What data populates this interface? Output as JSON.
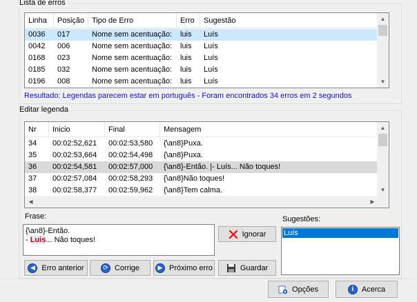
{
  "errors_group": {
    "title": "Lista de erros",
    "columns": [
      "Linha",
      "Posição",
      "Tipo de Erro",
      "Erro",
      "Sugestão"
    ],
    "rows": [
      [
        "0036",
        "017",
        "Nome sem acentuação:",
        "luis",
        "Luís"
      ],
      [
        "0042",
        "006",
        "Nome sem acentuação:",
        "luis",
        "Luís"
      ],
      [
        "0168",
        "023",
        "Nome sem acentuação:",
        "luis",
        "Luís"
      ],
      [
        "0185",
        "032",
        "Nome sem acentuação:",
        "luis",
        "Luís"
      ],
      [
        "0196",
        "008",
        "Nome sem acentuação:",
        "luis",
        "Luís"
      ]
    ],
    "result": "Resultado: Legendas parecem estar em português - Foram encontrados 34 erros em 2 segundos"
  },
  "edit_group": {
    "title": "Editar legenda",
    "columns": [
      "Nr",
      "Inicio",
      "Final",
      "Mensagem"
    ],
    "rows": [
      [
        "34",
        "00:02:52,621",
        "00:02:53,580",
        "{\\an8}Puxa."
      ],
      [
        "35",
        "00:02:53,664",
        "00:02:54,498",
        "{\\an8}Puxa."
      ],
      [
        "36",
        "00:02:54,581",
        "00:02:57,000",
        "{\\an8}-Então. |- Luís... Não toques!"
      ],
      [
        "37",
        "00:02:57,084",
        "00:02:58,293",
        "{\\an8}Não toques!"
      ],
      [
        "38",
        "00:02:58,377",
        "00:02:59,962",
        "{\\an8}Tem calma."
      ]
    ]
  },
  "phrase": {
    "label": "Frase:",
    "line1": "{\\an8}-Então.",
    "line2_prefix": "- ",
    "line2_highlight": "Luis",
    "line2_suffix": "... Não toques!"
  },
  "suggestions": {
    "label": "Sugestões:",
    "items": [
      "Luís"
    ]
  },
  "buttons": {
    "ignore": "Ignorar",
    "save": "Guardar",
    "prev_error": "Erro anterior",
    "fix": "Corrige",
    "next_error": "Próximo erro",
    "options": "Opções",
    "about": "Acerca"
  },
  "colors": {
    "selection_blue": "#cce8ff",
    "selection_gray": "#d9d9d9",
    "result_text": "#1010c8",
    "highlight_red": "#d00000",
    "accent": "#0078d7"
  }
}
